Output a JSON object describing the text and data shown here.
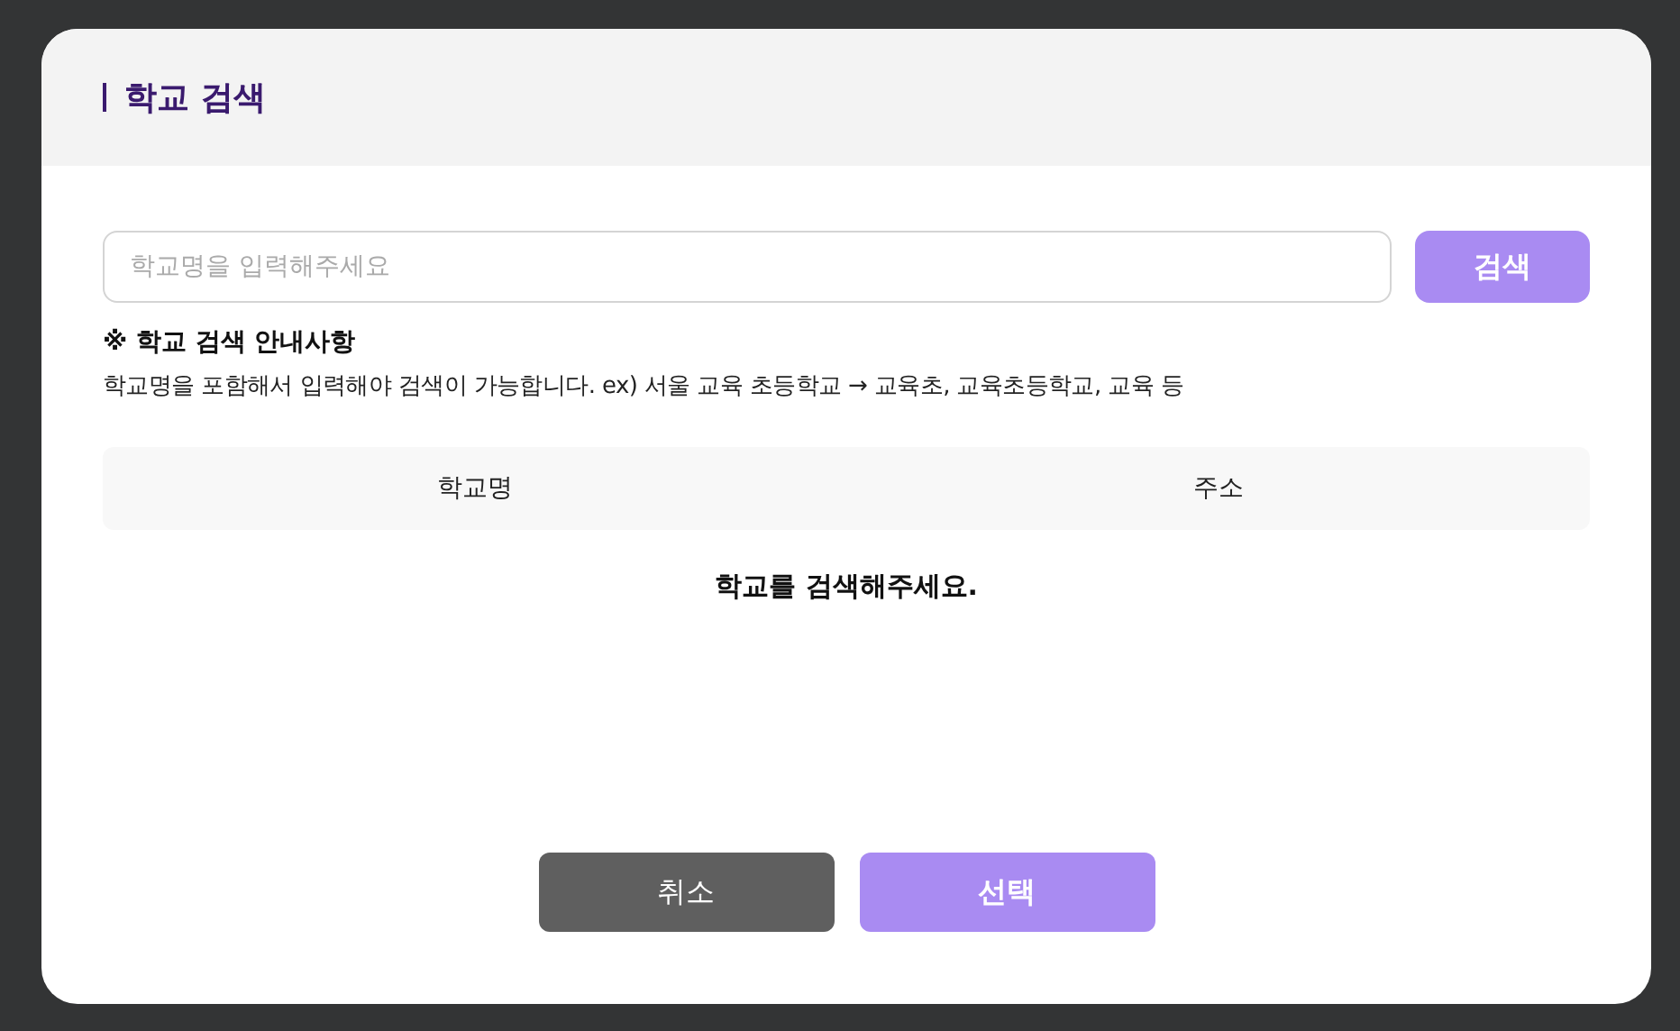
{
  "dialog": {
    "title": "학교 검색"
  },
  "search": {
    "placeholder": "학교명을 입력해주세요",
    "button": {
      "label": "검색",
      "disabled": true
    }
  },
  "notice": {
    "heading": "※ 학교 검색 안내사항",
    "text": "학교명을 포함해서 입력해야 검색이 가능합니다. ex) 서울 교육 초등학교 → 교육초, 교육초등학교, 교육 등"
  },
  "table": {
    "columns": [
      "학교명",
      "주소"
    ],
    "empty_message": "학교를 검색해주세요."
  },
  "buttons": [
    {
      "label": "취소",
      "kind": "cancel",
      "disabled": false
    },
    {
      "label": "선택",
      "kind": "confirm",
      "disabled": true
    }
  ]
}
